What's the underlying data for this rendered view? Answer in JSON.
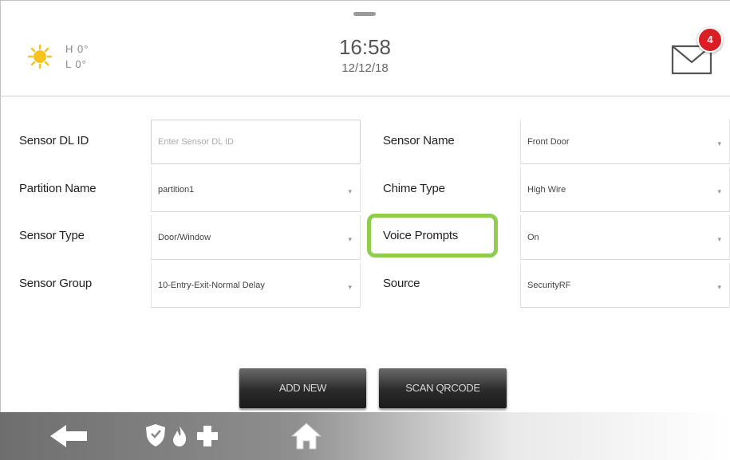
{
  "header": {
    "weather_icon": "sun-icon",
    "temp_high": "H 0°",
    "temp_low": "L 0°",
    "time": "16:58",
    "date": "12/12/18",
    "message_icon": "envelope-icon",
    "message_count": "4"
  },
  "form": {
    "sensor_dl_id": {
      "label": "Sensor DL ID",
      "value": "",
      "placeholder": "Enter Sensor DL ID"
    },
    "sensor_name": {
      "label": "Sensor Name",
      "value": "Front Door"
    },
    "partition_name": {
      "label": "Partition Name",
      "value": "partition1"
    },
    "chime_type": {
      "label": "Chime Type",
      "value": "High Wire"
    },
    "sensor_type": {
      "label": "Sensor Type",
      "value": "Door/Window"
    },
    "voice_prompts": {
      "label": "Voice Prompts",
      "value": "On"
    },
    "sensor_group": {
      "label": "Sensor Group",
      "value": "10-Entry-Exit-Normal Delay"
    },
    "source": {
      "label": "Source",
      "value": "SecurityRF"
    }
  },
  "buttons": {
    "add_new": "ADD NEW",
    "scan_qrcode": "SCAN QRCODE"
  },
  "bottom_bar": {
    "icons": [
      "back-arrow-icon",
      "shield-icon",
      "fire-icon",
      "medical-cross-icon",
      "home-icon"
    ]
  },
  "colors": {
    "highlight": "#8fcd4c",
    "badge": "#d81f26",
    "sun": "#f7c31c"
  }
}
